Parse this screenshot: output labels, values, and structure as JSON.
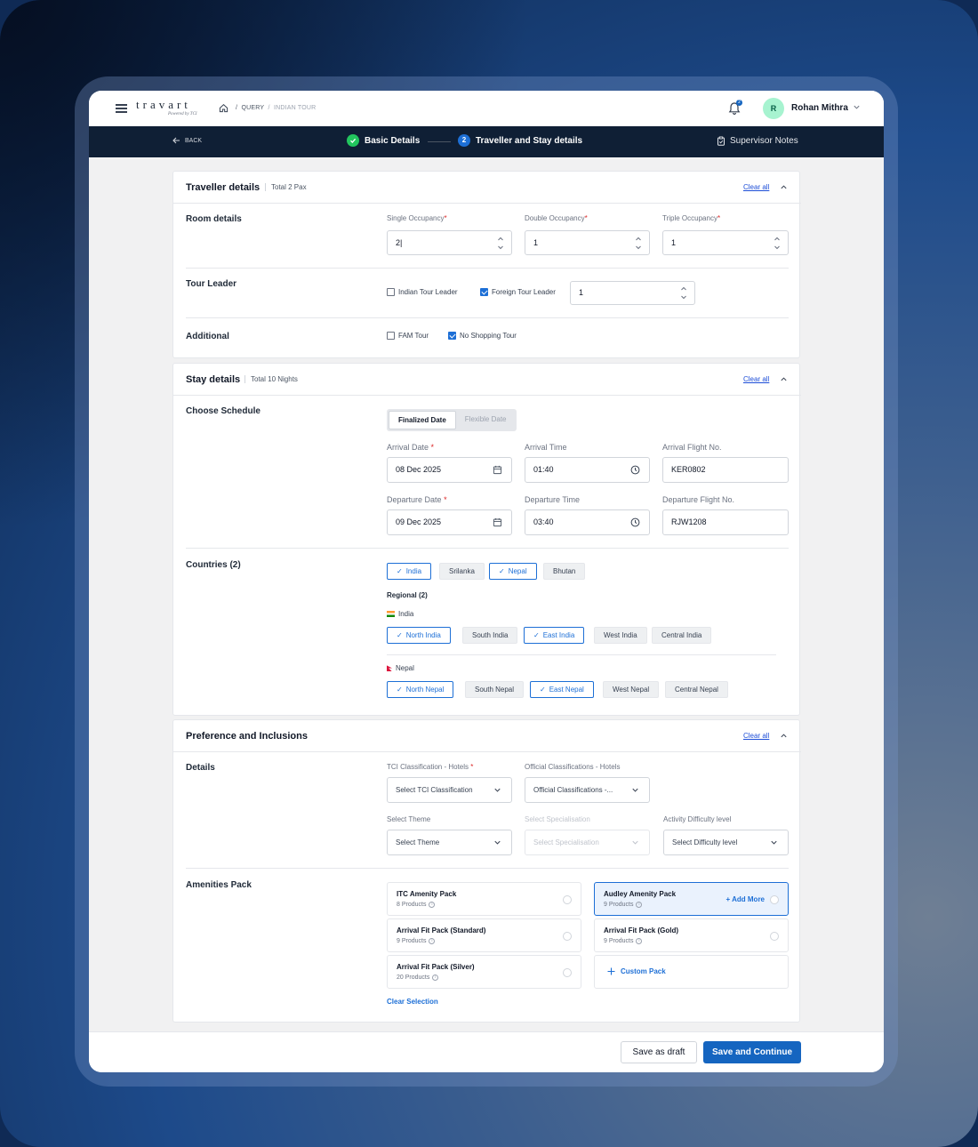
{
  "header": {
    "logo": "travart",
    "logo_sub": "Powered by TCI",
    "breadcrumb": [
      "QUERY",
      "INDIAN TOUR"
    ],
    "notification_count": "2",
    "user_initial": "R",
    "user_name": "Rohan Mithra"
  },
  "stepper": {
    "back_label": "BACK",
    "step1_label": "Basic Details",
    "step2_number": "2",
    "step2_label": "Traveller and Stay details",
    "supervisor_label": "Supervisor Notes"
  },
  "traveller": {
    "title": "Traveller details",
    "subtitle": "Total 2 Pax",
    "clear_all": "Clear all",
    "room_label": "Room details",
    "single_label": "Single Occupancy",
    "double_label": "Double Occupancy",
    "triple_label": "Triple Occupancy",
    "single_value": "2|",
    "double_value": "1",
    "triple_value": "1",
    "tour_leader_label": "Tour Leader",
    "indian_leader": "Indian Tour Leader",
    "foreign_leader": "Foreign Tour Leader",
    "leader_count": "1",
    "additional_label": "Additional",
    "fam_tour": "FAM Tour",
    "no_shopping": "No Shopping Tour"
  },
  "stay": {
    "title": "Stay details",
    "subtitle": "Total 10 Nights",
    "clear_all": "Clear all",
    "schedule_label": "Choose Schedule",
    "seg_finalized": "Finalized Date",
    "seg_flexible": "Flexible Date",
    "arrival_date_label": "Arrival Date",
    "arrival_date": "08 Dec 2025",
    "arrival_time_label": "Arrival Time",
    "arrival_time": "01:40",
    "arrival_flight_label": "Arrival Flight No.",
    "arrival_flight": "KER0802",
    "departure_date_label": "Departure Date",
    "departure_date": "09 Dec 2025",
    "departure_time_label": "Departure Time",
    "departure_time": "03:40",
    "departure_flight_label": "Departure Flight No.",
    "departure_flight": "RJW1208",
    "countries_label": "Countries (2)",
    "countries": [
      "India",
      "Srilanka",
      "Nepal",
      "Bhutan"
    ],
    "regional_label": "Regional (2)",
    "india_label": "India",
    "india_regions": [
      "North India",
      "South India",
      "East India",
      "West India",
      "Central India"
    ],
    "nepal_label": "Nepal",
    "nepal_regions": [
      "North Nepal",
      "South Nepal",
      "East Nepal",
      "West Nepal",
      "Central Nepal"
    ]
  },
  "preference": {
    "title": "Preference and Inclusions",
    "clear_all": "Clear all",
    "details_label": "Details",
    "tci_label": "TCI Classification - Hotels",
    "tci_placeholder": "Select TCI Classification",
    "official_label": "Official Classifications - Hotels",
    "official_placeholder": "Official Classifications -...",
    "theme_label": "Select Theme",
    "theme_placeholder": "Select Theme",
    "spec_label": "Select Specialisation",
    "spec_placeholder": "Select Specialisation",
    "difficulty_label": "Activity Difficulty level",
    "difficulty_placeholder": "Select  Difficulty level",
    "amenities_label": "Amenities Pack",
    "packs": [
      {
        "name": "ITC Amenity Pack",
        "count": "8 Products"
      },
      {
        "name": "Audley Amenity Pack",
        "count": "9 Products"
      },
      {
        "name": "Arrival Fit Pack (Standard)",
        "count": "9 Products"
      },
      {
        "name": "Arrival Fit Pack (Gold)",
        "count": "9 Products"
      },
      {
        "name": "Arrival Fit Pack (Silver)",
        "count": "20 Products"
      }
    ],
    "add_more": "+ Add More",
    "custom_pack": "Custom Pack",
    "clear_selection": "Clear Selection"
  },
  "footer": {
    "draft_label": "Save as draft",
    "save_label": "Save and Continue"
  },
  "colors": {
    "primary": "#1565c0",
    "nav_bg": "#0f1f35",
    "success": "#22c55e"
  }
}
